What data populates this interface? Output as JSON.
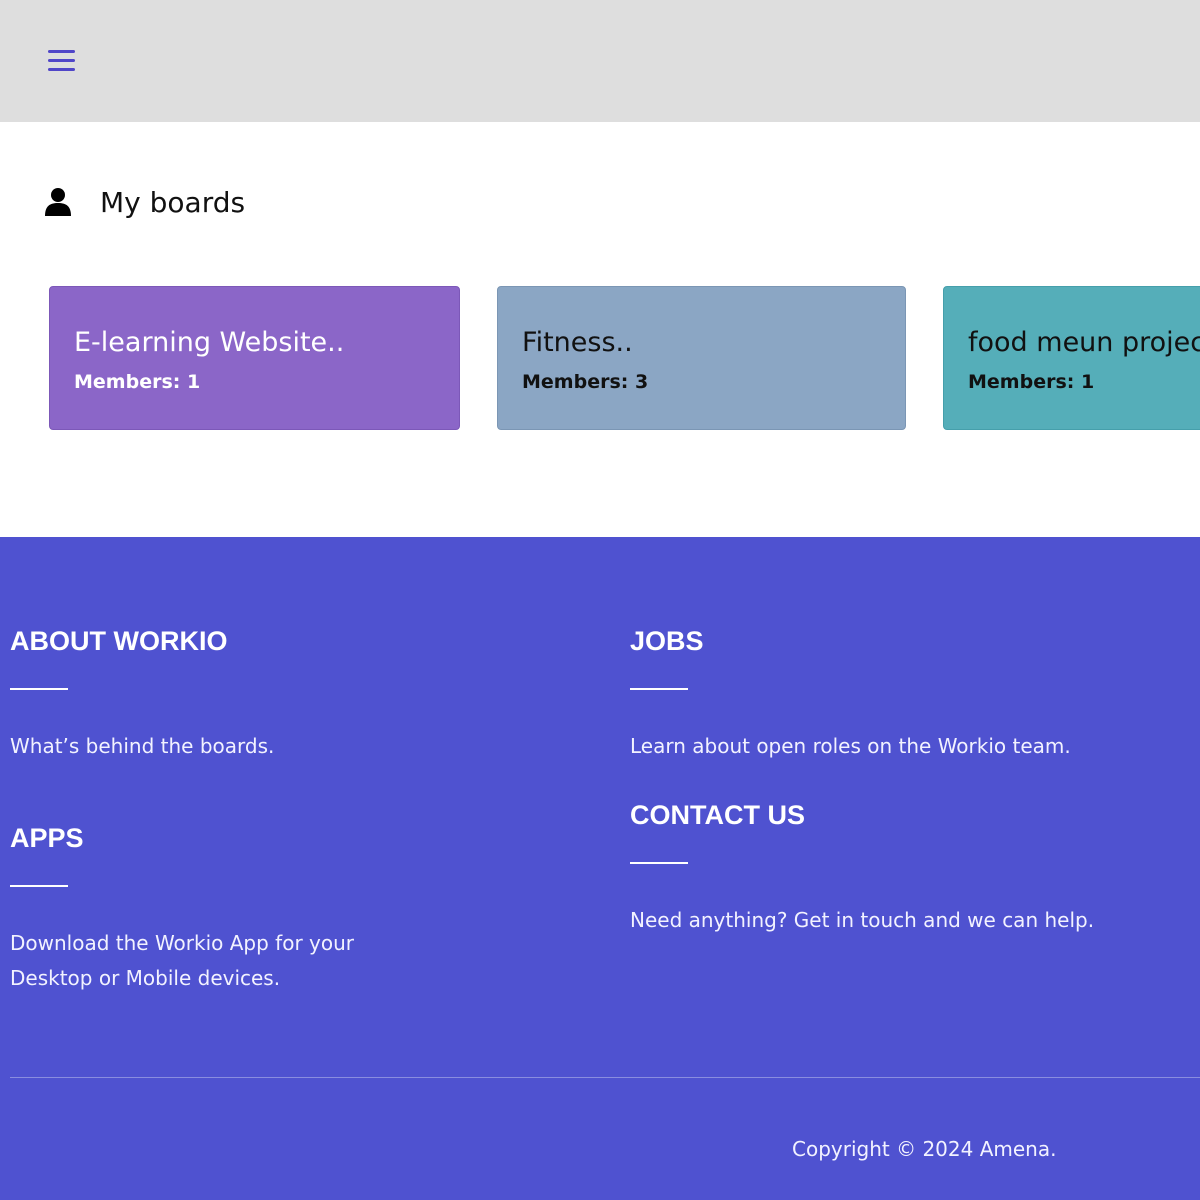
{
  "header": {
    "menu_icon": "hamburger-menu-icon",
    "accent_color": "#5046c8",
    "background": "#dedede"
  },
  "boards": {
    "icon": "user-icon",
    "title": "My boards",
    "items": [
      {
        "name": "E-learning Website..",
        "members": "Members: 1",
        "color": "#8b66c8"
      },
      {
        "name": "Fitness..",
        "members": "Members: 3",
        "color": "#8ba6c4"
      },
      {
        "name": "food meun project",
        "members": "Members: 1",
        "color": "#55aeb9"
      }
    ]
  },
  "footer": {
    "background": "#4f52d0",
    "about": {
      "heading": "ABOUT WORKIO",
      "text": "What’s behind the boards."
    },
    "jobs": {
      "heading": "JOBS",
      "text": "Learn about open roles on the Workio team."
    },
    "apps": {
      "heading": "APPS",
      "text_line1": "Download the Workio App for your",
      "text_line2": "Desktop or Mobile devices."
    },
    "contact": {
      "heading": "CONTACT US",
      "text": "Need anything? Get in touch and we can help."
    },
    "copyright": "Copyright © 2024 Amena."
  }
}
